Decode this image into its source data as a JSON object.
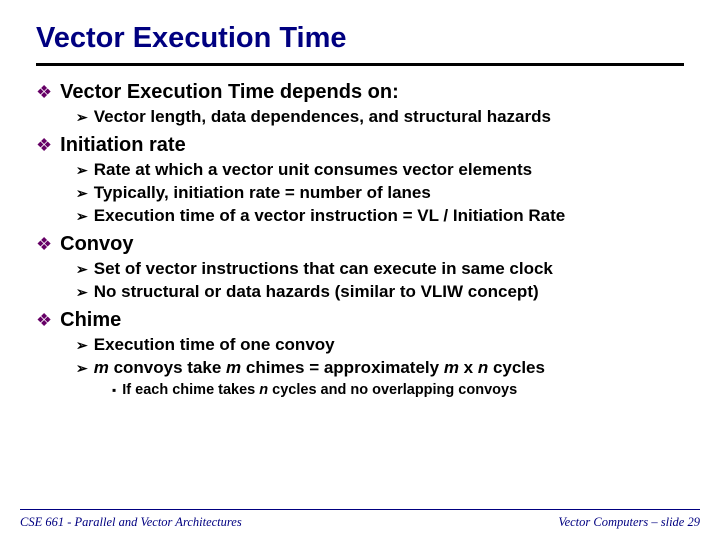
{
  "title": "Vector Execution Time",
  "items": {
    "i1": "Vector Execution Time depends on:",
    "i1_1": "Vector length, data dependences, and structural hazards",
    "i2": "Initiation rate",
    "i2_1": "Rate at which a vector unit consumes vector elements",
    "i2_2": "Typically, initiation rate = number of lanes",
    "i2_3": "Execution time of a vector instruction = VL / Initiation Rate",
    "i3": "Convoy",
    "i3_1": "Set of vector instructions that can execute in same clock",
    "i3_2": "No structural or data hazards (similar to VLIW concept)",
    "i4": "Chime",
    "i4_1": "Execution time of one convoy",
    "i4_2_a": "m",
    "i4_2_b": " convoys take ",
    "i4_2_c": "m",
    "i4_2_d": " chimes = approximately ",
    "i4_2_e": "m",
    "i4_2_f": " x ",
    "i4_2_g": "n",
    "i4_2_h": " cycles",
    "i4_2_1_a": "If each chime takes ",
    "i4_2_1_b": "n",
    "i4_2_1_c": " cycles and no overlapping convoys"
  },
  "footer": {
    "left": "CSE 661 - Parallel and Vector Architectures",
    "right": "Vector Computers – slide 29"
  }
}
